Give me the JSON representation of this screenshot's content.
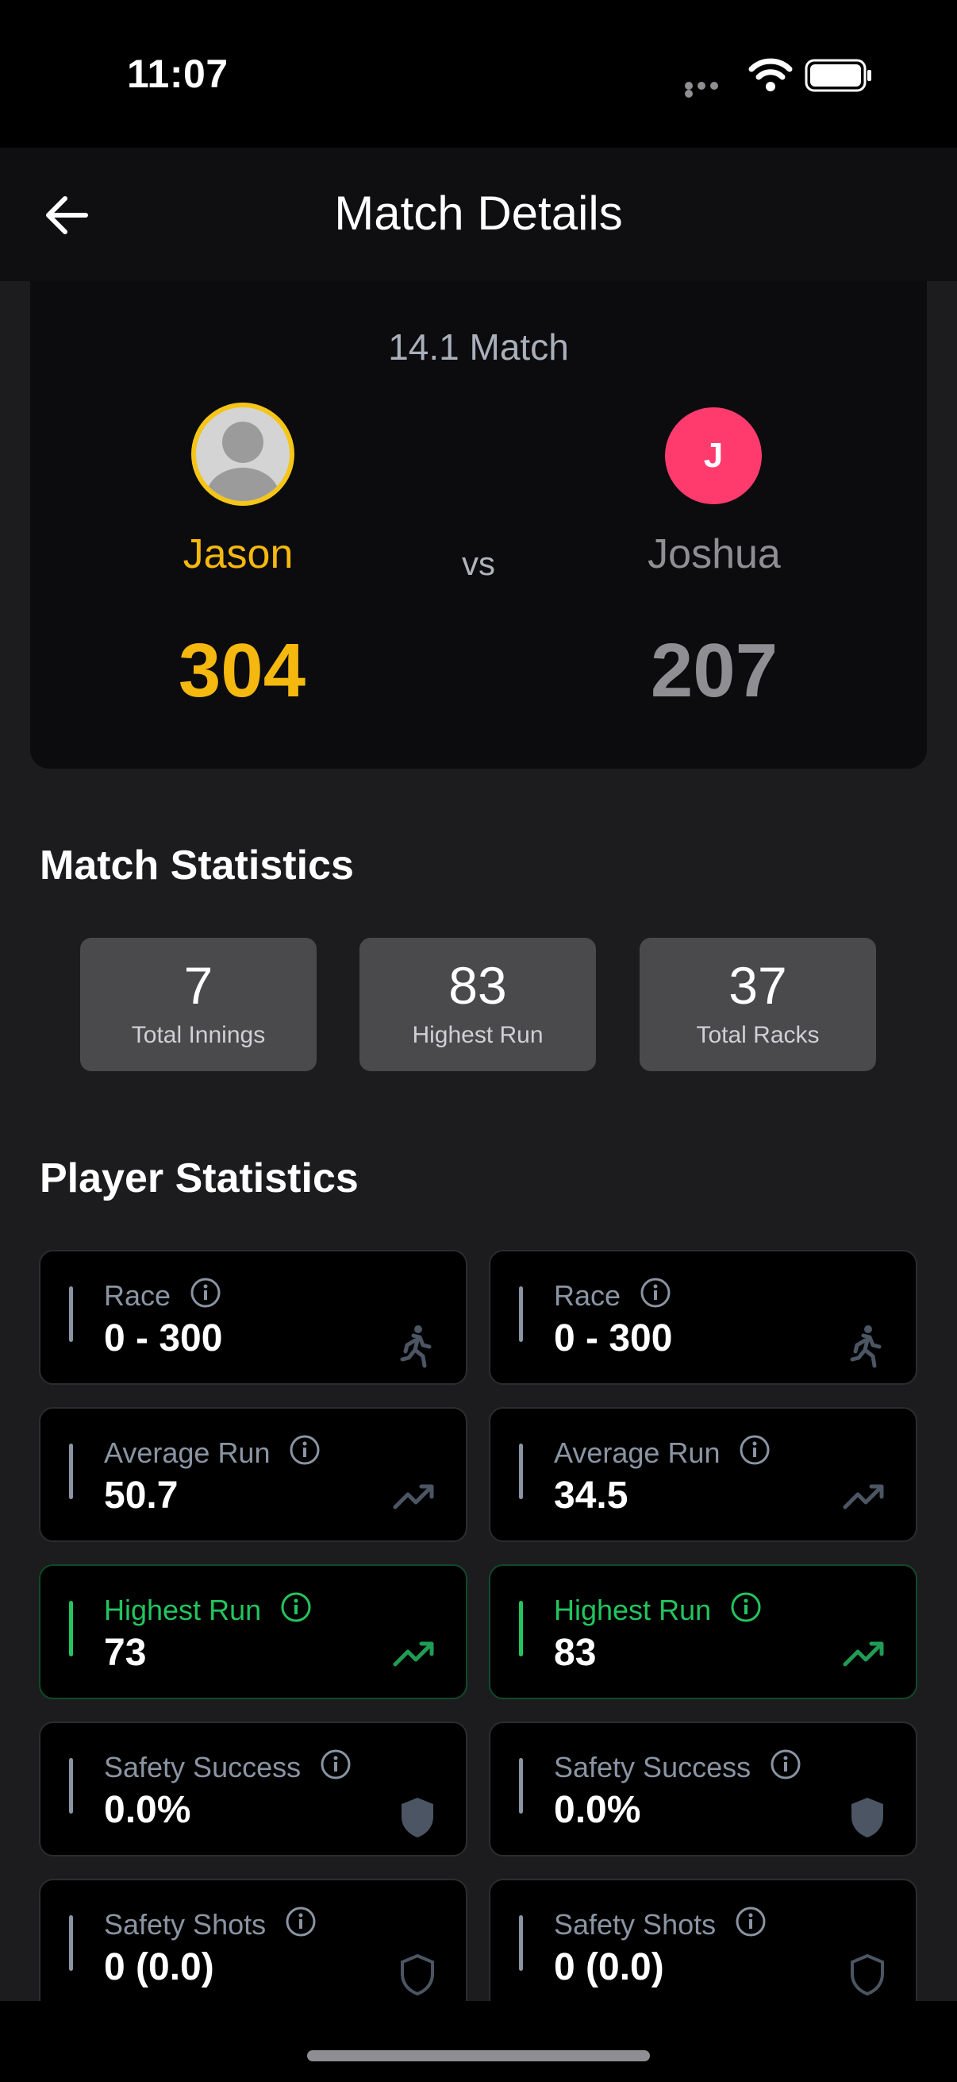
{
  "status_bar": {
    "time": "11:07"
  },
  "nav": {
    "title": "Match Details"
  },
  "match": {
    "type": "14.1 Match",
    "vs": "vs",
    "player_left": {
      "name": "Jason",
      "score": "304",
      "color": "#f5b80f"
    },
    "player_right": {
      "name": "Joshua",
      "initial": "J",
      "score": "207",
      "avatar_color": "#ff3b6e"
    }
  },
  "match_stats": {
    "title": "Match Statistics",
    "items": [
      {
        "value": "7",
        "label": "Total Innings"
      },
      {
        "value": "83",
        "label": "Highest Run"
      },
      {
        "value": "37",
        "label": "Total Racks"
      }
    ]
  },
  "player_stats": {
    "title": "Player Statistics",
    "highlight_color": "#22c55e",
    "left": [
      {
        "label": "Race",
        "value": "0 - 300",
        "icon": "run-icon"
      },
      {
        "label": "Average Run",
        "value": "50.7",
        "icon": "trend-icon"
      },
      {
        "label": "Highest Run",
        "value": "73",
        "icon": "trend-icon"
      },
      {
        "label": "Safety Success",
        "value": "0.0%",
        "icon": "shield-filled-icon"
      },
      {
        "label": "Safety Shots",
        "value": "0 (0.0)",
        "icon": "shield-outline-icon"
      }
    ],
    "right": [
      {
        "label": "Race",
        "value": "0 - 300",
        "icon": "run-icon"
      },
      {
        "label": "Average Run",
        "value": "34.5",
        "icon": "trend-icon"
      },
      {
        "label": "Highest Run",
        "value": "83",
        "icon": "trend-icon"
      },
      {
        "label": "Safety Success",
        "value": "0.0%",
        "icon": "shield-filled-icon"
      },
      {
        "label": "Safety Shots",
        "value": "0 (0.0)",
        "icon": "shield-outline-icon"
      }
    ]
  }
}
